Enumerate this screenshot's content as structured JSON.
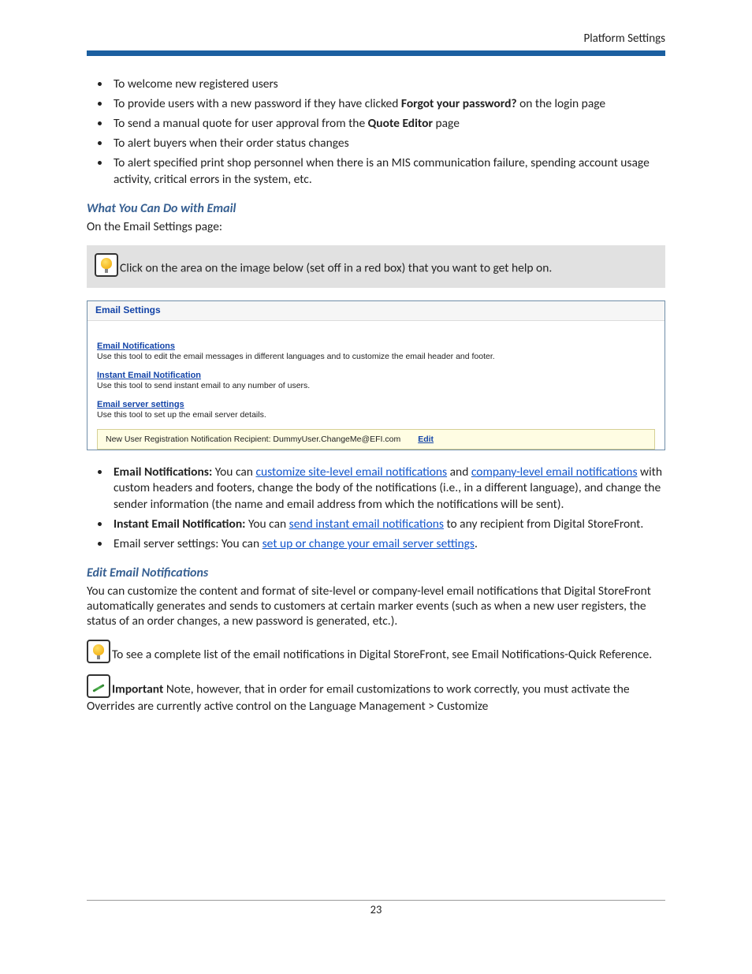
{
  "header": {
    "title": "Platform Settings"
  },
  "intro_bullets": [
    {
      "pre": "To welcome new registered users"
    },
    {
      "pre": "To provide users with a new password if they have clicked ",
      "bold": "Forgot your password?",
      "post": " on the login page"
    },
    {
      "pre": "To send a manual quote for user approval from the ",
      "bold": "Quote Editor",
      "post": " page"
    },
    {
      "pre": "To alert buyers when their order status changes"
    },
    {
      "pre": "To alert specified print shop personnel when there is an MIS communication failure, spending account usage activity, critical errors in the system, etc."
    }
  ],
  "section1": {
    "heading": "What You Can Do with Email",
    "intro": "On the Email Settings page:",
    "tip": "Click on the area on the image below (set off in a red box) that you want to get help on."
  },
  "emailPanel": {
    "title": "Email Settings",
    "items": [
      {
        "link": "Email Notifications",
        "desc": "Use this tool to edit the email messages in different languages and to customize the email header and footer."
      },
      {
        "link": "Instant Email Notification",
        "desc": "Use this tool to send instant email to any number of users."
      },
      {
        "link": "Email server settings",
        "desc": "Use this tool to set up the email server details."
      }
    ],
    "bottomBar": {
      "text": "New User Registration Notification Recipient: DummyUser.ChangeMe@EFI.com",
      "editLabel": "Edit"
    }
  },
  "afterPanelBullets": {
    "b1": {
      "bold": "Email Notifications:",
      "t1": " You can ",
      "link1": "customize site-level email notifications",
      "t2": " and ",
      "link2": "company-level email notifications",
      "t3": " with custom headers and footers, change the body of the notifications (i.e., in a different language), and change the sender information (the name and email address from which the notifications will be sent)."
    },
    "b2": {
      "bold": "Instant Email Notification:",
      "t1": " You can ",
      "link1": "send instant email notifications",
      "t2": " to any recipient from Digital StoreFront."
    },
    "b3": {
      "t1": "Email server settings: You can ",
      "link1": "set up or change your email server settings",
      "t2": "."
    }
  },
  "section2": {
    "heading": "Edit Email Notifications",
    "para": "You can customize the content and format of site-level or company-level email notifications that Digital StoreFront automatically generates and sends to customers at certain marker events (such as when a new user registers, the status of an order changes, a new password is generated, etc.).",
    "tip": "To see a complete list of the email notifications in Digital StoreFront, see Email Notifications-Quick Reference.",
    "important_bold": "Important",
    "important_text": " Note, however, that in order for email customizations to work correctly, you must activate the Overrides are currently active control on the Language Management > Customize"
  },
  "footer": {
    "pageNumber": "23"
  }
}
